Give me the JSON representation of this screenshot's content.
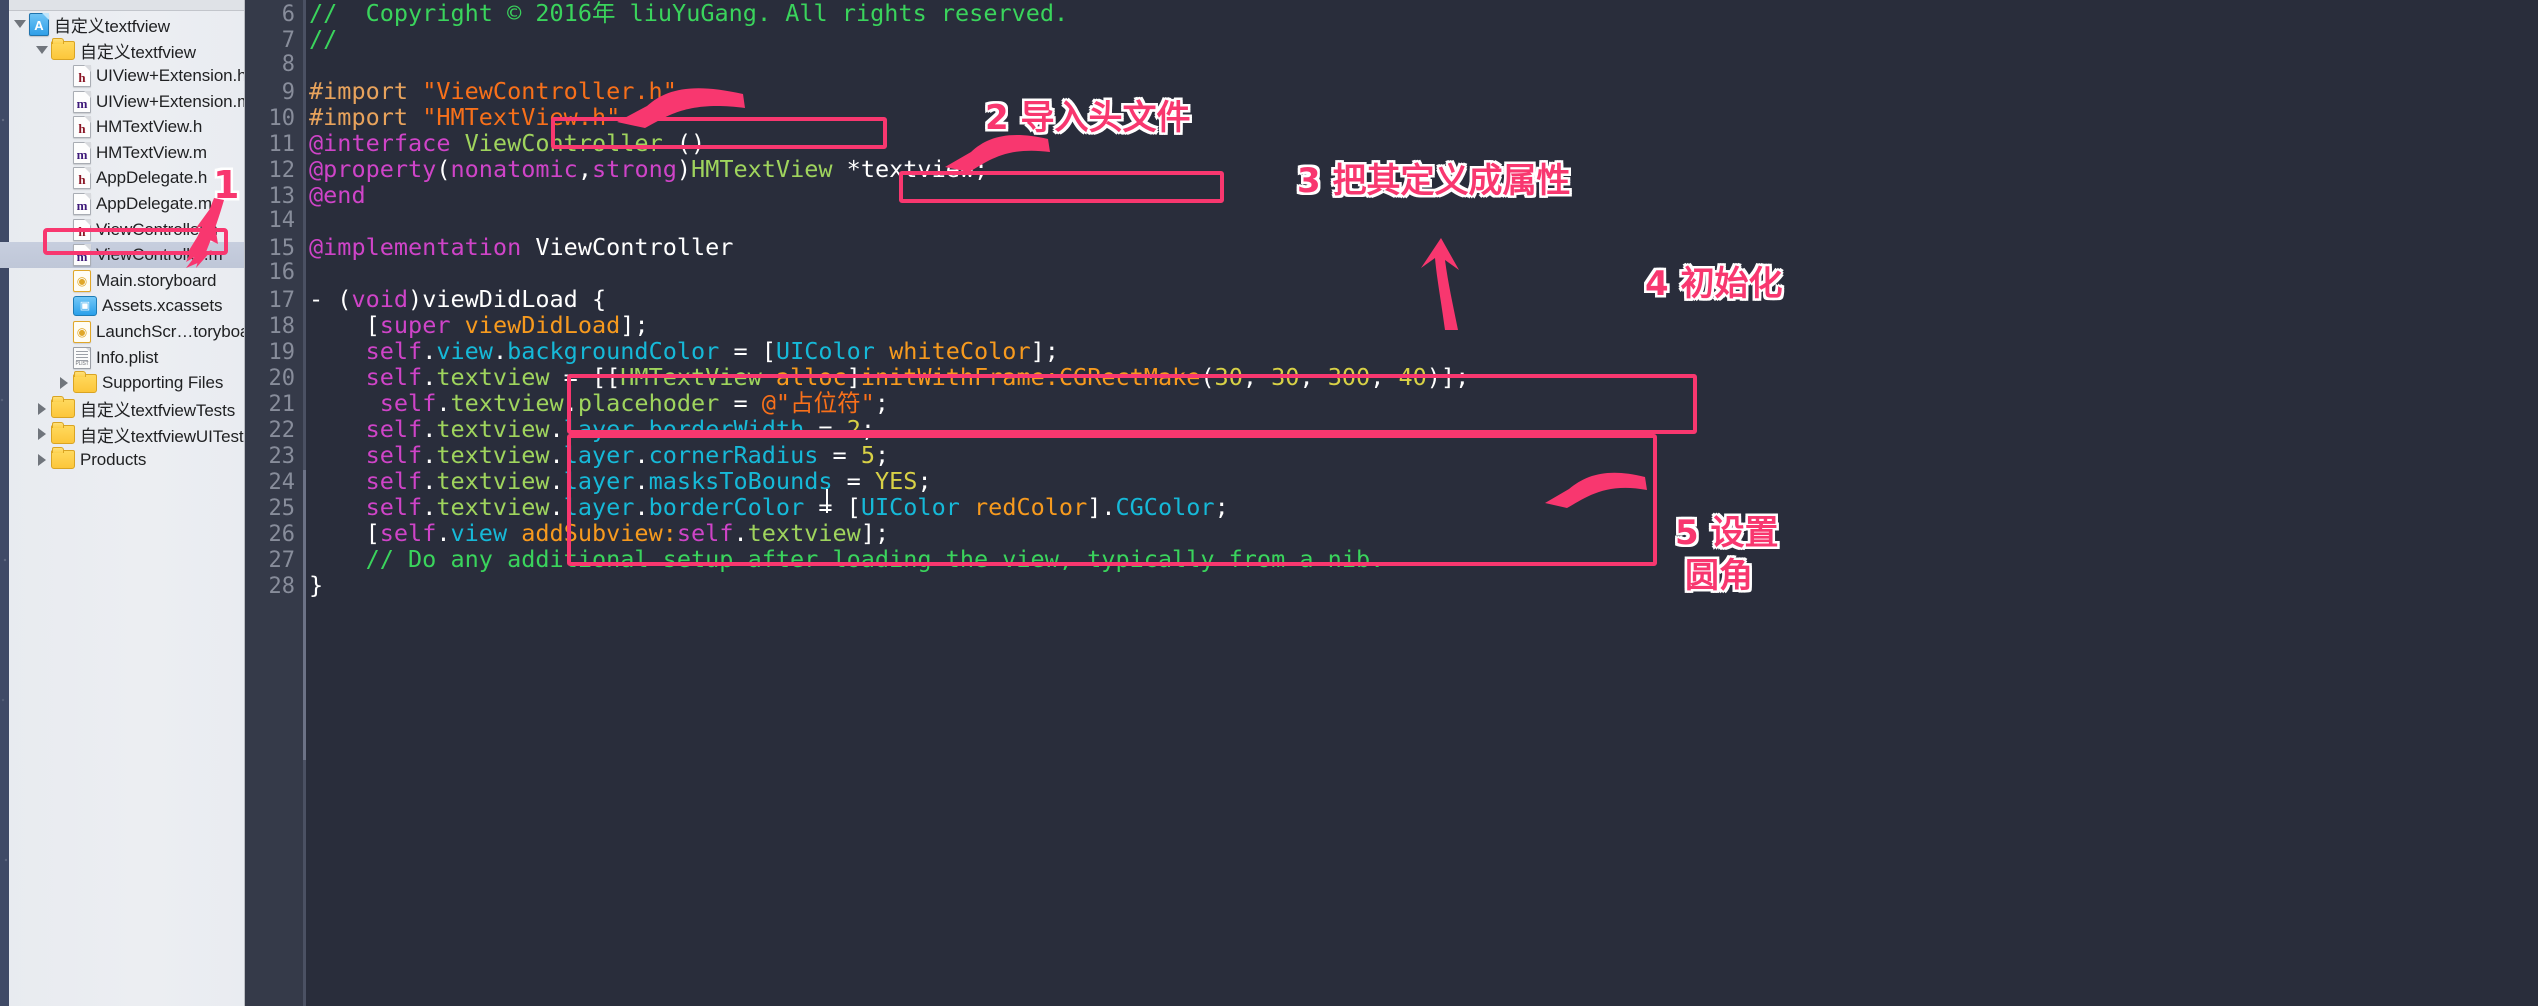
{
  "app": {
    "kind": "xcode-editor"
  },
  "sidebar": {
    "items": [
      {
        "label": "自定义textfview",
        "icon": "xcode-project-icon",
        "indent": 0,
        "disclosure": "open",
        "type": "project",
        "glyph": "A"
      },
      {
        "label": "自定义textfview",
        "icon": "folder-icon",
        "indent": 1,
        "disclosure": "open",
        "type": "folder",
        "glyph": ""
      },
      {
        "label": "UIView+Extension.h",
        "icon": "header-file-icon",
        "indent": 2,
        "disclosure": "none",
        "type": "h",
        "glyph": "h"
      },
      {
        "label": "UIView+Extension.m",
        "icon": "source-file-icon",
        "indent": 2,
        "disclosure": "none",
        "type": "m",
        "glyph": "m"
      },
      {
        "label": "HMTextView.h",
        "icon": "header-file-icon",
        "indent": 2,
        "disclosure": "none",
        "type": "h",
        "glyph": "h"
      },
      {
        "label": "HMTextView.m",
        "icon": "source-file-icon",
        "indent": 2,
        "disclosure": "none",
        "type": "m",
        "glyph": "m"
      },
      {
        "label": "AppDelegate.h",
        "icon": "header-file-icon",
        "indent": 2,
        "disclosure": "none",
        "type": "h",
        "glyph": "h"
      },
      {
        "label": "AppDelegate.m",
        "icon": "source-file-icon",
        "indent": 2,
        "disclosure": "none",
        "type": "m",
        "glyph": "m"
      },
      {
        "label": "ViewController.h",
        "icon": "header-file-icon",
        "indent": 2,
        "disclosure": "none",
        "type": "h",
        "glyph": "h"
      },
      {
        "label": "ViewController.m",
        "icon": "source-file-icon",
        "indent": 2,
        "disclosure": "none",
        "type": "m",
        "glyph": "m",
        "selected": true
      },
      {
        "label": "Main.storyboard",
        "icon": "storyboard-icon",
        "indent": 2,
        "disclosure": "none",
        "type": "sb",
        "glyph": "◉"
      },
      {
        "label": "Assets.xcassets",
        "icon": "asset-catalog-icon",
        "indent": 2,
        "disclosure": "none",
        "type": "xca",
        "glyph": "▣"
      },
      {
        "label": "LaunchScr…toryboard",
        "icon": "storyboard-icon",
        "indent": 2,
        "disclosure": "none",
        "type": "sb",
        "glyph": "◉"
      },
      {
        "label": "Info.plist",
        "icon": "plist-icon",
        "indent": 2,
        "disclosure": "none",
        "type": "plist",
        "glyph": "PLIST"
      },
      {
        "label": "Supporting Files",
        "icon": "folder-icon",
        "indent": 2,
        "disclosure": "closed",
        "type": "folder",
        "glyph": ""
      },
      {
        "label": "自定义textfviewTests",
        "icon": "folder-icon",
        "indent": 1,
        "disclosure": "closed",
        "type": "folder",
        "glyph": ""
      },
      {
        "label": "自定义textfviewUITests",
        "icon": "folder-icon",
        "indent": 1,
        "disclosure": "closed",
        "type": "folder",
        "glyph": ""
      },
      {
        "label": "Products",
        "icon": "folder-icon",
        "indent": 1,
        "disclosure": "closed",
        "type": "folder",
        "glyph": ""
      }
    ]
  },
  "editor": {
    "lines": [
      {
        "num": "6",
        "tokens": [
          {
            "t": "//  Copyright © 2016年 liuYuGang. All rights reserved.",
            "c": "c-com"
          }
        ]
      },
      {
        "num": "7",
        "tokens": [
          {
            "t": "//",
            "c": "c-com"
          }
        ]
      },
      {
        "num": "8",
        "tokens": [
          {
            "t": "",
            "c": "c-pln"
          }
        ]
      },
      {
        "num": "9",
        "tokens": [
          {
            "t": "#import ",
            "c": "c-pre"
          },
          {
            "t": "\"ViewController.h\"",
            "c": "c-str"
          }
        ]
      },
      {
        "num": "10",
        "tokens": [
          {
            "t": "#import ",
            "c": "c-pre"
          },
          {
            "t": "\"HMTextView.h\"",
            "c": "c-str"
          }
        ]
      },
      {
        "num": "11",
        "tokens": [
          {
            "t": "@interface ",
            "c": "c-kw"
          },
          {
            "t": "ViewController",
            "c": "c-type"
          },
          {
            "t": " ()",
            "c": "c-punc"
          }
        ]
      },
      {
        "num": "12",
        "tokens": [
          {
            "t": "@property",
            "c": "c-kw"
          },
          {
            "t": "(",
            "c": "c-punc"
          },
          {
            "t": "nonatomic",
            "c": "c-kw"
          },
          {
            "t": ",",
            "c": "c-punc"
          },
          {
            "t": "strong",
            "c": "c-kw"
          },
          {
            "t": ")",
            "c": "c-punc"
          },
          {
            "t": "HMTextView",
            "c": "c-type"
          },
          {
            "t": " *textview;",
            "c": "c-punc"
          }
        ]
      },
      {
        "num": "13",
        "tokens": [
          {
            "t": "@end",
            "c": "c-kw"
          }
        ]
      },
      {
        "num": "14",
        "tokens": [
          {
            "t": "",
            "c": "c-pln"
          }
        ]
      },
      {
        "num": "15",
        "tokens": [
          {
            "t": "@implementation ",
            "c": "c-kw"
          },
          {
            "t": "ViewController",
            "c": "c-pln"
          }
        ]
      },
      {
        "num": "16",
        "tokens": [
          {
            "t": "",
            "c": "c-pln"
          }
        ]
      },
      {
        "num": "17",
        "tokens": [
          {
            "t": "- (",
            "c": "c-pln"
          },
          {
            "t": "void",
            "c": "c-kw"
          },
          {
            "t": ")viewDidLoad {",
            "c": "c-pln"
          }
        ]
      },
      {
        "num": "18",
        "tokens": [
          {
            "t": "    [",
            "c": "c-pln"
          },
          {
            "t": "super",
            "c": "c-kw"
          },
          {
            "t": " ",
            "c": "c-pln"
          },
          {
            "t": "viewDidLoad",
            "c": "c-msg"
          },
          {
            "t": "];",
            "c": "c-pln"
          }
        ]
      },
      {
        "num": "19",
        "tokens": [
          {
            "t": "    ",
            "c": "c-pln"
          },
          {
            "t": "self",
            "c": "c-kw"
          },
          {
            "t": ".",
            "c": "c-pln"
          },
          {
            "t": "view",
            "c": "c-prop"
          },
          {
            "t": ".",
            "c": "c-pln"
          },
          {
            "t": "backgroundColor",
            "c": "c-prop"
          },
          {
            "t": " = [",
            "c": "c-pln"
          },
          {
            "t": "UIColor",
            "c": "c-prop"
          },
          {
            "t": " ",
            "c": "c-pln"
          },
          {
            "t": "whiteColor",
            "c": "c-msg"
          },
          {
            "t": "];",
            "c": "c-pln"
          }
        ]
      },
      {
        "num": "20",
        "tokens": [
          {
            "t": "    ",
            "c": "c-pln"
          },
          {
            "t": "self",
            "c": "c-kw"
          },
          {
            "t": ".",
            "c": "c-pln"
          },
          {
            "t": "textview",
            "c": "c-type"
          },
          {
            "t": " = [[",
            "c": "c-pln"
          },
          {
            "t": "HMTextView",
            "c": "c-type"
          },
          {
            "t": " ",
            "c": "c-pln"
          },
          {
            "t": "alloc",
            "c": "c-msg"
          },
          {
            "t": "]",
            "c": "c-pln"
          },
          {
            "t": "initWithFrame:",
            "c": "c-msg"
          },
          {
            "t": "CGRectMake",
            "c": "c-msg"
          },
          {
            "t": "(",
            "c": "c-pln"
          },
          {
            "t": "30",
            "c": "c-num"
          },
          {
            "t": ", ",
            "c": "c-pln"
          },
          {
            "t": "30",
            "c": "c-num"
          },
          {
            "t": ", ",
            "c": "c-pln"
          },
          {
            "t": "300",
            "c": "c-num"
          },
          {
            "t": ", ",
            "c": "c-pln"
          },
          {
            "t": "40",
            "c": "c-num"
          },
          {
            "t": ")];",
            "c": "c-pln"
          }
        ]
      },
      {
        "num": "21",
        "tokens": [
          {
            "t": "     ",
            "c": "c-pln"
          },
          {
            "t": "self",
            "c": "c-kw"
          },
          {
            "t": ".",
            "c": "c-pln"
          },
          {
            "t": "textview",
            "c": "c-type"
          },
          {
            "t": ".",
            "c": "c-pln"
          },
          {
            "t": "placehoder",
            "c": "c-type"
          },
          {
            "t": " = ",
            "c": "c-pln"
          },
          {
            "t": "@\"占位符\"",
            "c": "c-str"
          },
          {
            "t": ";",
            "c": "c-pln"
          }
        ]
      },
      {
        "num": "22",
        "tokens": [
          {
            "t": "    ",
            "c": "c-pln"
          },
          {
            "t": "self",
            "c": "c-kw"
          },
          {
            "t": ".",
            "c": "c-pln"
          },
          {
            "t": "textview",
            "c": "c-type"
          },
          {
            "t": ".",
            "c": "c-pln"
          },
          {
            "t": "layer",
            "c": "c-prop"
          },
          {
            "t": ".",
            "c": "c-pln"
          },
          {
            "t": "borderWidth",
            "c": "c-prop"
          },
          {
            "t": " = ",
            "c": "c-pln"
          },
          {
            "t": "2",
            "c": "c-num"
          },
          {
            "t": ";",
            "c": "c-pln"
          }
        ]
      },
      {
        "num": "23",
        "tokens": [
          {
            "t": "    ",
            "c": "c-pln"
          },
          {
            "t": "self",
            "c": "c-kw"
          },
          {
            "t": ".",
            "c": "c-pln"
          },
          {
            "t": "textview",
            "c": "c-type"
          },
          {
            "t": ".",
            "c": "c-pln"
          },
          {
            "t": "layer",
            "c": "c-prop"
          },
          {
            "t": ".",
            "c": "c-pln"
          },
          {
            "t": "cornerRadius",
            "c": "c-prop"
          },
          {
            "t": " = ",
            "c": "c-pln"
          },
          {
            "t": "5",
            "c": "c-num"
          },
          {
            "t": ";",
            "c": "c-pln"
          }
        ]
      },
      {
        "num": "24",
        "tokens": [
          {
            "t": "    ",
            "c": "c-pln"
          },
          {
            "t": "self",
            "c": "c-kw"
          },
          {
            "t": ".",
            "c": "c-pln"
          },
          {
            "t": "textview",
            "c": "c-type"
          },
          {
            "t": ".",
            "c": "c-pln"
          },
          {
            "t": "layer",
            "c": "c-prop"
          },
          {
            "t": ".",
            "c": "c-pln"
          },
          {
            "t": "masksToBounds",
            "c": "c-prop"
          },
          {
            "t": " = ",
            "c": "c-pln"
          },
          {
            "t": "YES",
            "c": "c-num"
          },
          {
            "t": ";",
            "c": "c-pln"
          }
        ]
      },
      {
        "num": "25",
        "tokens": [
          {
            "t": "    ",
            "c": "c-pln"
          },
          {
            "t": "self",
            "c": "c-kw"
          },
          {
            "t": ".",
            "c": "c-pln"
          },
          {
            "t": "textview",
            "c": "c-type"
          },
          {
            "t": ".",
            "c": "c-pln"
          },
          {
            "t": "layer",
            "c": "c-prop"
          },
          {
            "t": ".",
            "c": "c-pln"
          },
          {
            "t": "borderColor",
            "c": "c-prop"
          },
          {
            "t": " = [",
            "c": "c-pln"
          },
          {
            "t": "UIColor",
            "c": "c-prop"
          },
          {
            "t": " ",
            "c": "c-pln"
          },
          {
            "t": "redColor",
            "c": "c-msg"
          },
          {
            "t": "].",
            "c": "c-pln"
          },
          {
            "t": "CGColor",
            "c": "c-prop"
          },
          {
            "t": ";",
            "c": "c-pln"
          }
        ]
      },
      {
        "num": "26",
        "tokens": [
          {
            "t": "    [",
            "c": "c-pln"
          },
          {
            "t": "self",
            "c": "c-kw"
          },
          {
            "t": ".",
            "c": "c-pln"
          },
          {
            "t": "view",
            "c": "c-prop"
          },
          {
            "t": " ",
            "c": "c-pln"
          },
          {
            "t": "addSubview:",
            "c": "c-msg"
          },
          {
            "t": "self",
            "c": "c-kw"
          },
          {
            "t": ".",
            "c": "c-pln"
          },
          {
            "t": "textview",
            "c": "c-type"
          },
          {
            "t": "];",
            "c": "c-pln"
          }
        ]
      },
      {
        "num": "27",
        "tokens": [
          {
            "t": "    // Do any additional setup after loading the view, typically from a nib.",
            "c": "c-com"
          }
        ]
      },
      {
        "num": "28",
        "tokens": [
          {
            "t": "}",
            "c": "c-pln"
          }
        ]
      }
    ]
  },
  "annotations": {
    "accent_color": "#f8376f",
    "notes": [
      {
        "id": "note1",
        "text": "1"
      },
      {
        "id": "note2",
        "text": "2 导入头文件"
      },
      {
        "id": "note3",
        "text": "3 把其定义成属性"
      },
      {
        "id": "note4",
        "text": "4 初始化"
      },
      {
        "id": "note5",
        "text": "5 设置"
      },
      {
        "id": "note5b",
        "text": "圆角"
      }
    ],
    "highlight_boxes": [
      {
        "id": "box-selected-file",
        "target": "ViewController.m"
      },
      {
        "id": "box-import",
        "target": "#import \"HMTextView.h\""
      },
      {
        "id": "box-prop",
        "target": ")HMTextView *textview;"
      },
      {
        "id": "box-init",
        "target": "lines 20-21 initialization"
      },
      {
        "id": "box-layer",
        "target": "lines 22-26 layer settings"
      }
    ]
  }
}
